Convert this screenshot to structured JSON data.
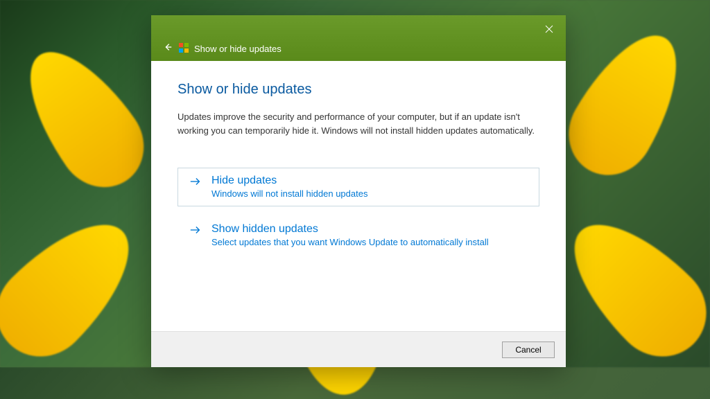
{
  "titlebar": {
    "title": "Show or hide updates"
  },
  "content": {
    "heading": "Show or hide updates",
    "description": "Updates improve the security and performance of your computer, but if an update isn't working you can temporarily hide it. Windows will not install hidden updates automatically."
  },
  "options": {
    "hide": {
      "title": "Hide updates",
      "subtitle": "Windows will not install hidden updates"
    },
    "show": {
      "title": "Show hidden updates",
      "subtitle": "Select updates that you want Windows Update to automatically install"
    }
  },
  "footer": {
    "cancel_label": "Cancel"
  }
}
